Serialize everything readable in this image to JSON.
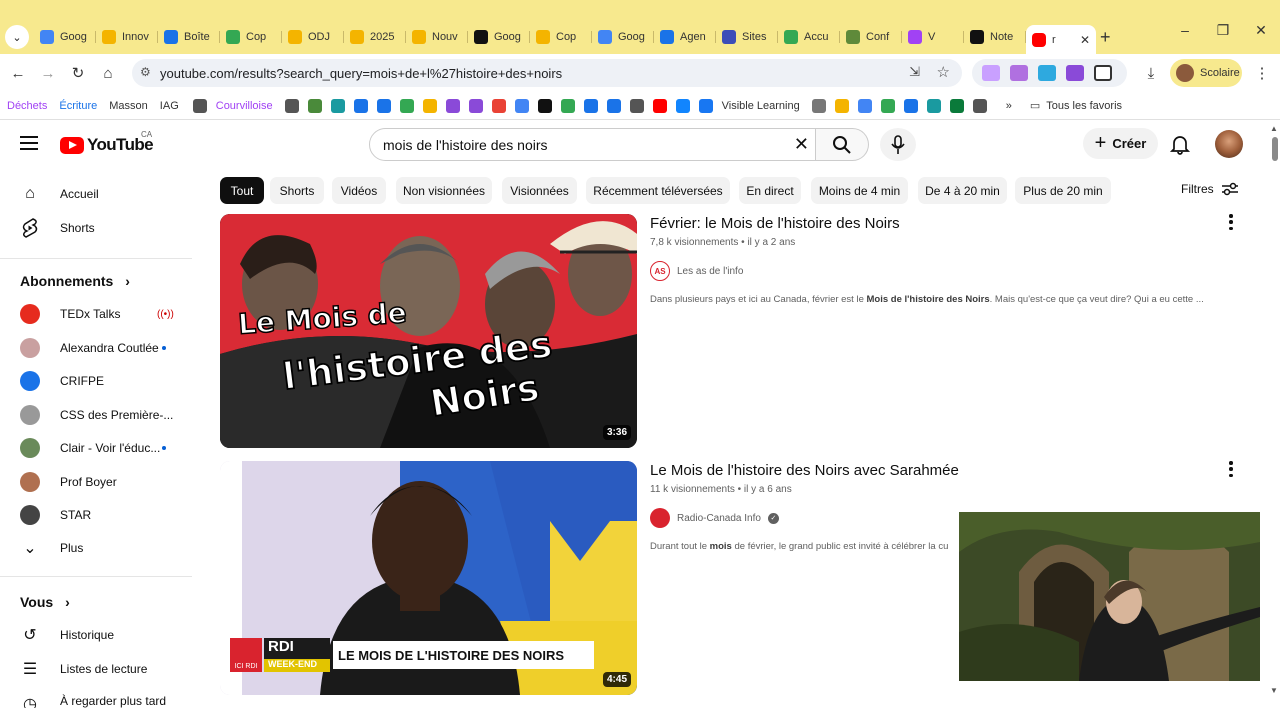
{
  "browser": {
    "tabs": [
      {
        "label": "Goog",
        "icon": "gemini-icon",
        "color": "#4285f4"
      },
      {
        "label": "Innov",
        "icon": "slides-icon",
        "color": "#f4b400"
      },
      {
        "label": "Boîte",
        "icon": "folder-icon",
        "color": "#1a73e8"
      },
      {
        "label": "Cop",
        "icon": "drive-icon",
        "color": "#34a853"
      },
      {
        "label": "ODJ",
        "icon": "slides-icon",
        "color": "#f4b400"
      },
      {
        "label": "2025",
        "icon": "slides-icon",
        "color": "#f4b400"
      },
      {
        "label": "Nouv",
        "icon": "slides-icon",
        "color": "#f4b400"
      },
      {
        "label": "Goog",
        "icon": "openai-icon",
        "color": "#111111"
      },
      {
        "label": "Cop",
        "icon": "slides-icon",
        "color": "#f4b400"
      },
      {
        "label": "Goog",
        "icon": "gemini-icon",
        "color": "#4285f4"
      },
      {
        "label": "Agen",
        "icon": "calendar-icon",
        "color": "#1a73e8"
      },
      {
        "label": "Sites",
        "icon": "sites-icon",
        "color": "#3c4eb8"
      },
      {
        "label": "Accu",
        "icon": "classroom-icon",
        "color": "#34a853"
      },
      {
        "label": "Conf",
        "icon": "puzzle-icon",
        "color": "#5f8a3a"
      },
      {
        "label": "V",
        "icon": "record-icon",
        "color": "#a142f4"
      },
      {
        "label": "Note",
        "icon": "openai-icon",
        "color": "#111111"
      }
    ],
    "active_tab": {
      "label": "r",
      "icon": "youtube-icon",
      "color": "#ff0000"
    },
    "url": "youtube.com/results?search_query=mois+de+l%27histoire+des+noirs",
    "profile_label": "Scolaire",
    "bookmarks": [
      {
        "label": "Déchets",
        "color": "#a142f4"
      },
      {
        "label": "Écriture",
        "color": "#1a73e8"
      },
      {
        "label": "Masson",
        "color": "#333333"
      },
      {
        "label": "IAG",
        "color": "#333333"
      },
      {
        "label": "Courvilloise",
        "color": "#a142f4"
      }
    ],
    "bookmark_visible_learning": "Visible Learning",
    "bookmark_all": "Tous les favoris"
  },
  "youtube": {
    "logo_text": "YouTube",
    "country_code": "CA",
    "search_query": "mois de l'histoire des noirs",
    "create_label": "Créer",
    "filters_label": "Filtres",
    "chips": [
      "Tout",
      "Shorts",
      "Vidéos",
      "Non visionnées",
      "Visionnées",
      "Récemment téléversées",
      "En direct",
      "Moins de 4 min",
      "De 4 à 20 min",
      "Plus de 20 min"
    ],
    "sidebar": {
      "home": "Accueil",
      "shorts": "Shorts",
      "subscriptions_header": "Abonnements",
      "subscriptions": [
        {
          "label": "TEDx Talks",
          "status": "live",
          "color": "#e62b1e"
        },
        {
          "label": "Alexandra Coutlée",
          "status": "new",
          "color": "#c9a0a0"
        },
        {
          "label": "CRIFPE",
          "status": "",
          "color": "#1a73e8"
        },
        {
          "label": "CSS des Première-...",
          "status": "",
          "color": "#999999"
        },
        {
          "label": "Clair - Voir l'éduc...",
          "status": "new",
          "color": "#6a8a5a"
        },
        {
          "label": "Prof Boyer",
          "status": "",
          "color": "#b07050"
        },
        {
          "label": "STAR",
          "status": "",
          "color": "#444444"
        }
      ],
      "more": "Plus",
      "you_header": "Vous",
      "history": "Historique",
      "playlists": "Listes de lecture",
      "cut_item": "À regarder plus tard"
    },
    "results": [
      {
        "title": "Février: le Mois de l'histoire des Noirs",
        "views": "7,8 k visionnements",
        "age": "il y a 2 ans",
        "channel": "Les as de l'info",
        "channel_color": "#d9232e",
        "verified": false,
        "description_pre": "Dans plusieurs pays et ici au Canada, février est le ",
        "description_bold": "Mois de l'histoire des Noirs",
        "description_post": ". Mais qu'est-ce que ça veut dire? Qui a eu cette ...",
        "duration": "3:36",
        "thumb_text_1": "Le Mois de",
        "thumb_text_2": "l'histoire des",
        "thumb_text_3": "Noirs"
      },
      {
        "title": "Le Mois de l'histoire des Noirs avec Sarahmée",
        "views": "11 k visionnements",
        "age": "il y a 6 ans",
        "channel": "Radio-Canada Info",
        "channel_color": "#d9232e",
        "verified": true,
        "description_pre": "Durant tout le ",
        "description_bold": "mois",
        "description_post": " de février, le grand public est invité à célébrer la cu",
        "duration": "4:45",
        "banner_network": "RDI",
        "banner_sub": "WEEK-END",
        "banner_text": "LE MOIS DE L'HISTOIRE DES NOIRS",
        "banner_logo_text": "ICI RDI"
      }
    ]
  },
  "colors": {
    "tabbar": "#f7e98e",
    "youtube_red": "#ff0000",
    "verified_gray": "#606060"
  }
}
